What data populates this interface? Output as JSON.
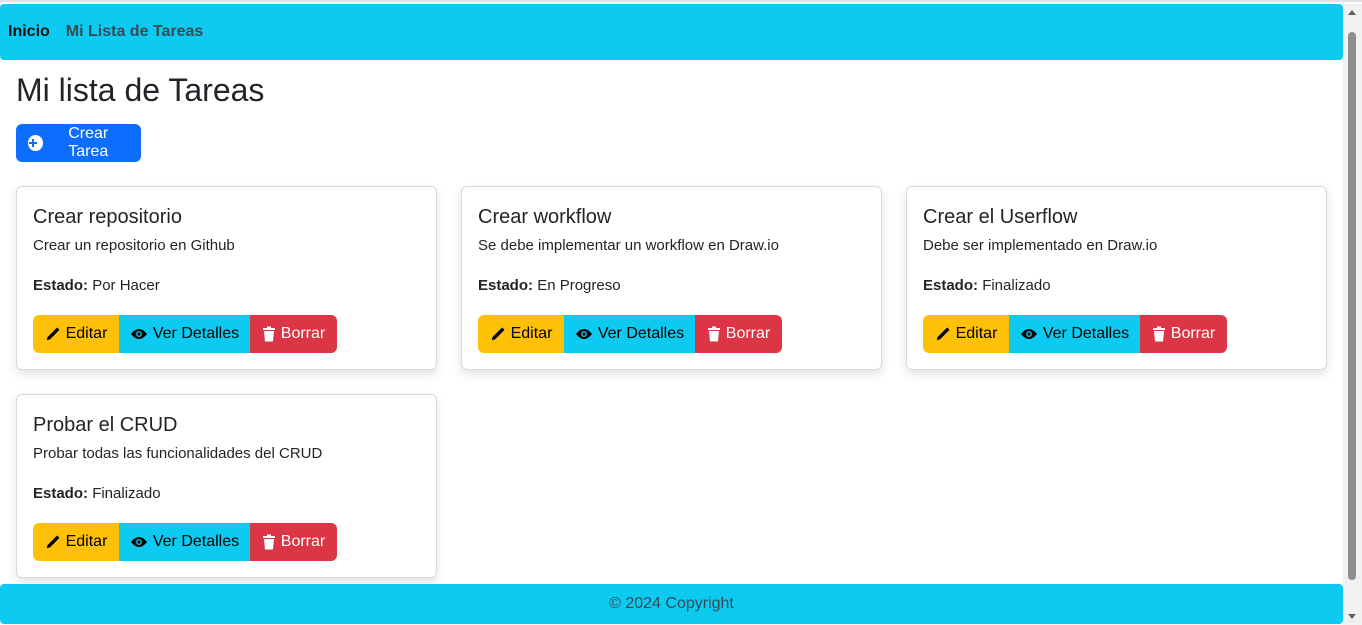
{
  "navbar": {
    "brand": "Inicio",
    "link": "Mi Lista de Tareas"
  },
  "page": {
    "title": "Mi lista de Tareas",
    "create_button": "Crear Tarea"
  },
  "status_label": "Estado:",
  "buttons": {
    "edit": "Editar",
    "view": "Ver Detalles",
    "delete": "Borrar"
  },
  "tasks": [
    {
      "title": "Crear repositorio",
      "description": "Crear un repositorio en Github",
      "status": "Por Hacer"
    },
    {
      "title": "Crear workflow",
      "description": "Se debe implementar un workflow en Draw.io",
      "status": "En Progreso"
    },
    {
      "title": "Crear el Userflow",
      "description": "Debe ser implementado en Draw.io",
      "status": "Finalizado"
    },
    {
      "title": "Probar el CRUD",
      "description": "Probar todas las funcionalidades del CRUD",
      "status": "Finalizado"
    }
  ],
  "footer": {
    "text": "© 2024 Copyright"
  },
  "colors": {
    "primary": "#0d6efd",
    "info": "#0dcaf0",
    "warning": "#ffc107",
    "danger": "#dc3545"
  },
  "icons": {
    "create": "plus-circle-icon",
    "edit": "pencil-icon",
    "view": "eye-icon",
    "delete": "trash-icon"
  }
}
